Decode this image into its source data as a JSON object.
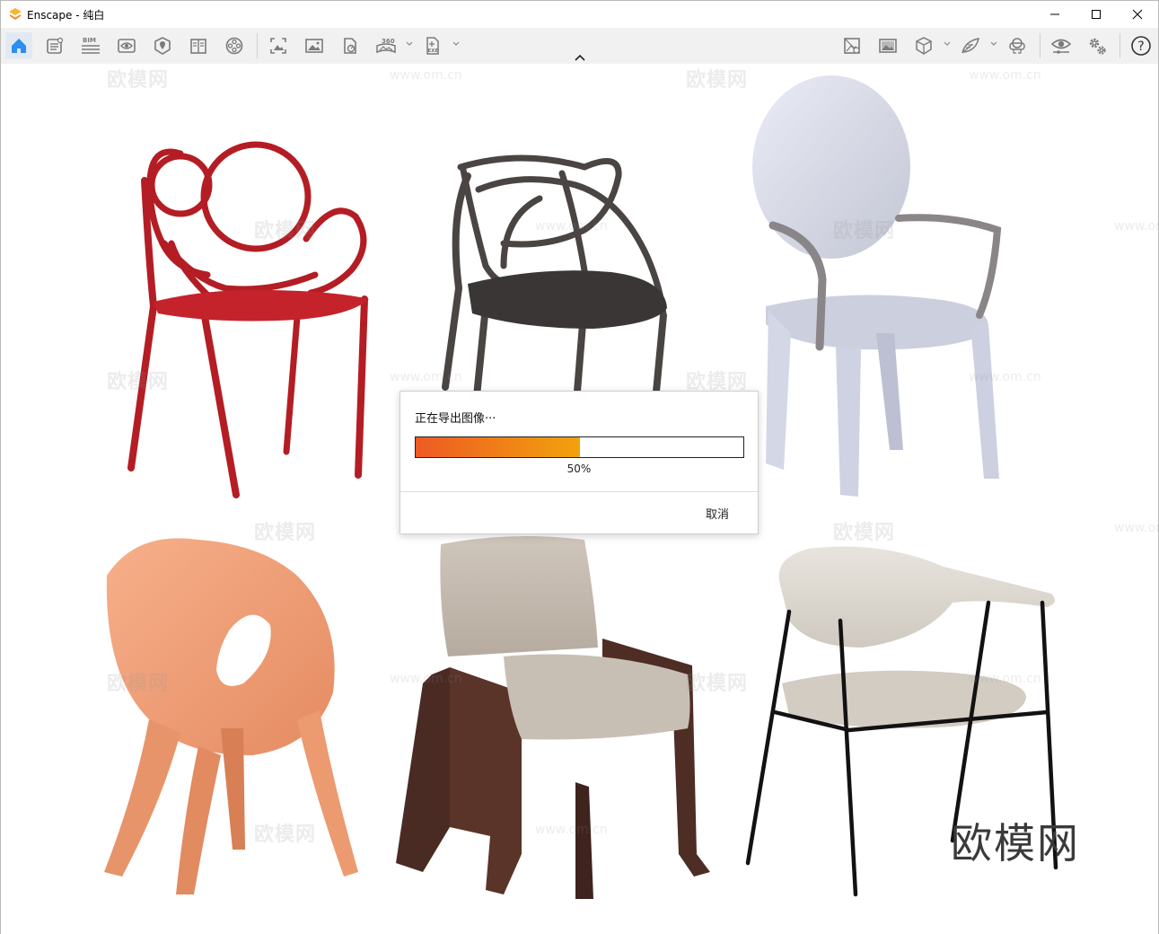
{
  "window": {
    "title": "Enscape - 纯白",
    "controls": [
      "minimize-icon",
      "maximize-icon",
      "close-icon"
    ]
  },
  "toolbar": {
    "left_icons": [
      "home-icon",
      "settings-sheet-icon",
      "bim-icon",
      "view-icon",
      "map-pin-icon",
      "book-icon",
      "reel-icon",
      "screenshot-icon",
      "image-icon",
      "export-file-icon",
      "panorama-360-icon",
      "exe-export-icon"
    ],
    "right_icons": [
      "batch-render-icon",
      "picture-gallery-icon",
      "asset-cube-icon",
      "material-feather-icon",
      "vr-headset-icon",
      "visibility-eye-icon",
      "gears-icon",
      "help-icon"
    ],
    "bim_label": "BIM",
    "pano_label": "360",
    "exe_label": "EXE",
    "help_label": "?"
  },
  "dialog": {
    "title": "正在导出图像···",
    "progress": 0.5,
    "progress_text": "50%",
    "cancel_label": "取消"
  },
  "watermark": {
    "text": "欧模网",
    "url": "www.om.cn"
  },
  "colors": {
    "accent": "#2a8ff0",
    "progress_start": "#ee5a24",
    "progress_end": "#f1a20c",
    "logo": "#f29b1d"
  }
}
